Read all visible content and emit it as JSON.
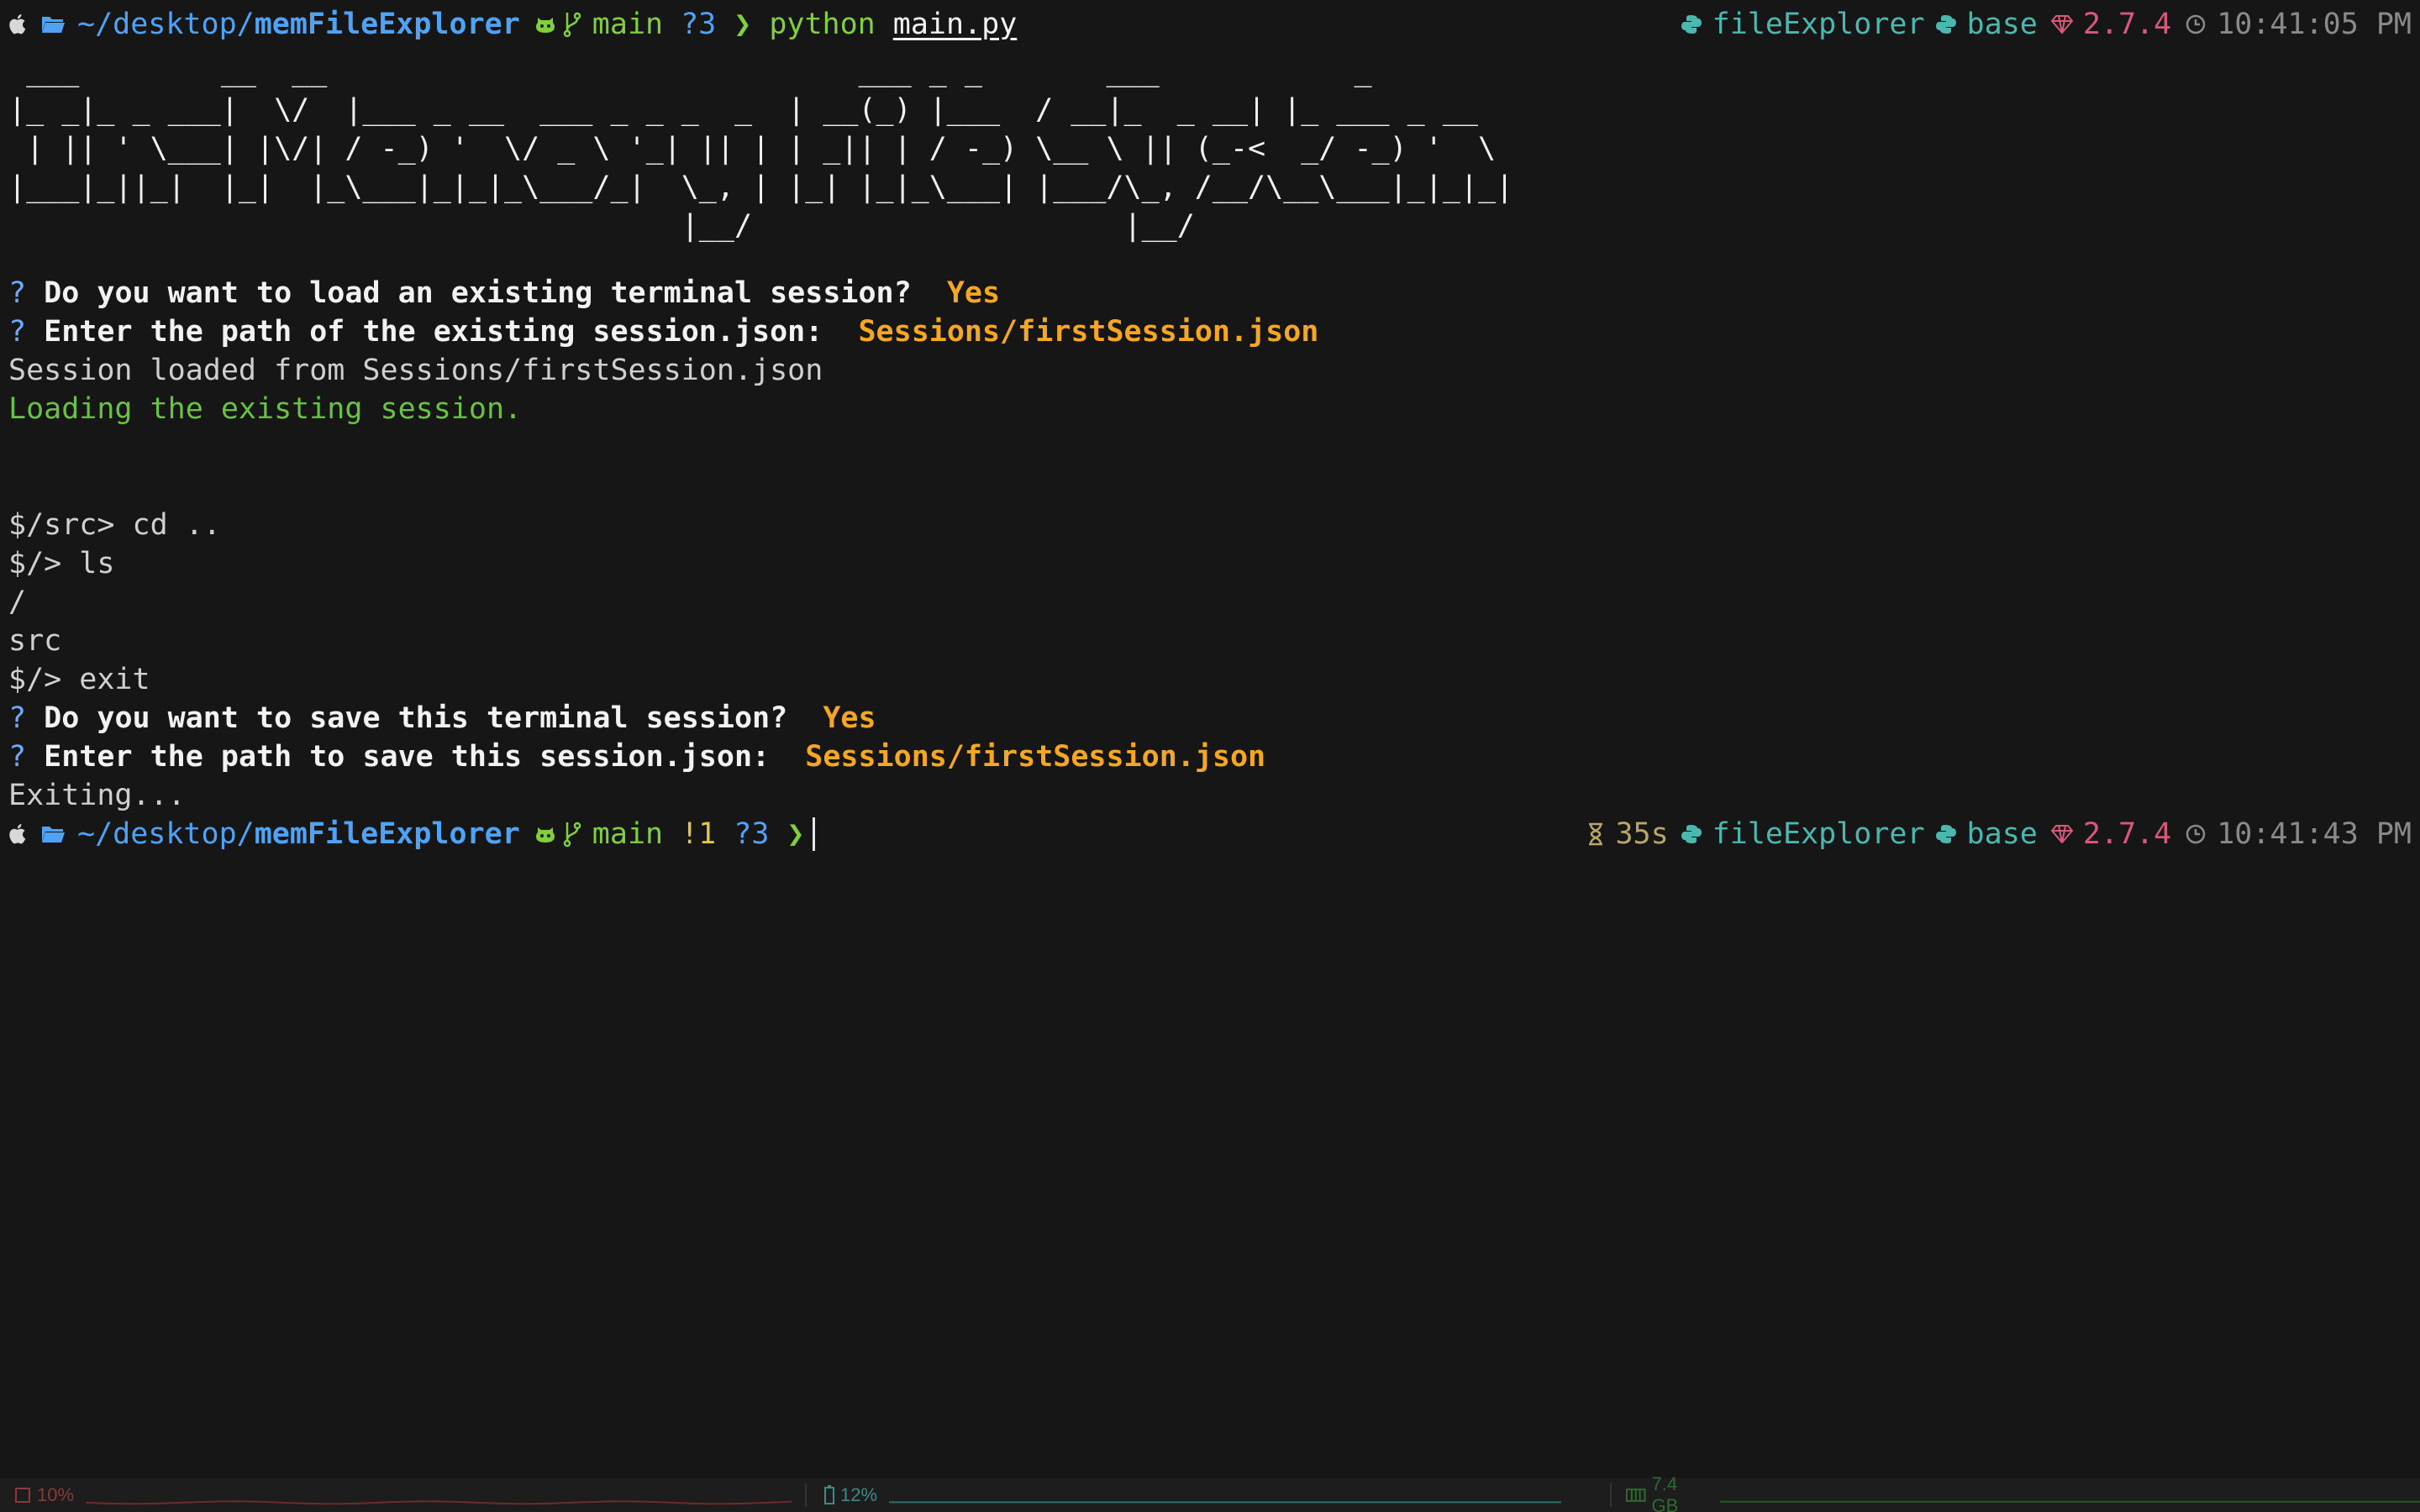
{
  "prompt1": {
    "path_prefix": "~/desktop/",
    "path_dir": "memFileExplorer",
    "branch": "main",
    "git_status": "?3",
    "command": "python",
    "command_arg": "main.py",
    "env_name": "fileExplorer",
    "conda_env": "base",
    "ruby_version": "2.7.4",
    "time": "10:41:05 PM"
  },
  "banner_ascii": " ___        __  __                              ___ _ _       ___           _\n|_ _|_ _ ___|  \\/  |___ _ __  ___ _ _ _  _  | __(_) |___  / __|_  _ __| |_ ___ _ __\n | || ' \\___| |\\/| / -_) '  \\/ _ \\ '_| || | | _|| | / -_) \\__ \\ || (_-<  _/ -_) '  \\\n|___|_||_|  |_|  |_\\___|_|_|_\\___/_|  \\_, | |_| |_|_\\___| |___/\\_, /__/\\__\\___|_|_|_|\n                                      |__/                     |__/",
  "session": {
    "q1_text": "Do you want to load an existing terminal session?",
    "q1_answer": "Yes",
    "q2_text": "Enter the path of the existing session.json:",
    "q2_answer": "Sessions/firstSession.json",
    "loaded_msg": "Session loaded from Sessions/firstSession.json",
    "loading_msg": "Loading the existing session."
  },
  "shell_lines": [
    "$/src> cd ..",
    "$/> ls",
    "/",
    "src",
    "$/> exit"
  ],
  "exit_session": {
    "q3_text": "Do you want to save this terminal session?",
    "q3_answer": "Yes",
    "q4_text": "Enter the path to save this session.json:",
    "q4_answer": "Sessions/firstSession.json",
    "exiting_msg": "Exiting..."
  },
  "prompt2": {
    "path_prefix": "~/desktop/",
    "path_dir": "memFileExplorer",
    "branch": "main",
    "git_modified": "!1",
    "git_status": "?3",
    "duration": "35s",
    "env_name": "fileExplorer",
    "conda_env": "base",
    "ruby_version": "2.7.4",
    "time": "10:41:43 PM"
  },
  "question_mark": "?",
  "prompt_chevron": "❯",
  "statusbar": {
    "cpu": "10%",
    "cpu_level": 0.1,
    "battery": "12%",
    "battery_level": 0.12,
    "memory": "7.4 GB"
  },
  "colors": {
    "background": "#161616",
    "path": "#4fa3f7",
    "git": "#7fd03c",
    "answer": "#f5a623",
    "env": "#4bb8b0",
    "ruby": "#d8587a",
    "success": "#69c242"
  }
}
